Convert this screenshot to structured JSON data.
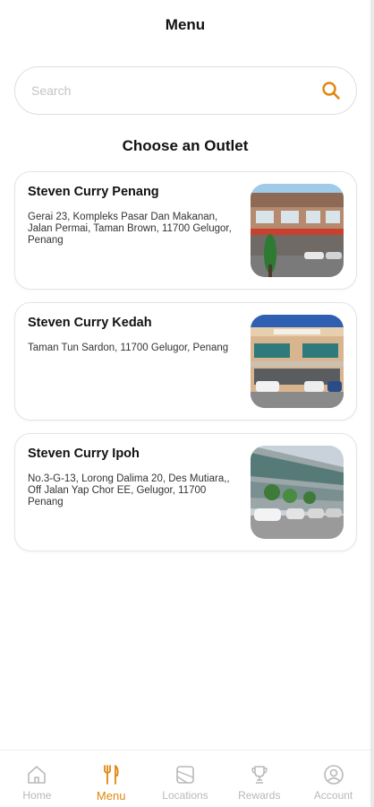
{
  "header": {
    "title": "Menu"
  },
  "search": {
    "placeholder": "Search"
  },
  "section_title": "Choose an Outlet",
  "outlets": [
    {
      "name": "Steven Curry Penang",
      "address": "Gerai 23, Kompleks Pasar Dan Makanan, Jalan Permai, Taman Brown, 11700 Gelugor, Penang"
    },
    {
      "name": "Steven Curry Kedah",
      "address": "Taman Tun Sardon, 11700 Gelugor, Penang"
    },
    {
      "name": "Steven Curry Ipoh",
      "address": "No.3-G-13, Lorong Dalima 20, Des Mutiara,, Off Jalan Yap Chor EE, Gelugor, 11700 Penang"
    }
  ],
  "tabs": [
    {
      "label": "Home",
      "icon": "home-icon"
    },
    {
      "label": "Menu",
      "icon": "fork-knife-icon",
      "active": true
    },
    {
      "label": "Locations",
      "icon": "map-icon"
    },
    {
      "label": "Rewards",
      "icon": "trophy-icon"
    },
    {
      "label": "Account",
      "icon": "user-circle-icon"
    }
  ],
  "colors": {
    "accent": "#e0860e",
    "inactive": "#b9b9b9"
  }
}
